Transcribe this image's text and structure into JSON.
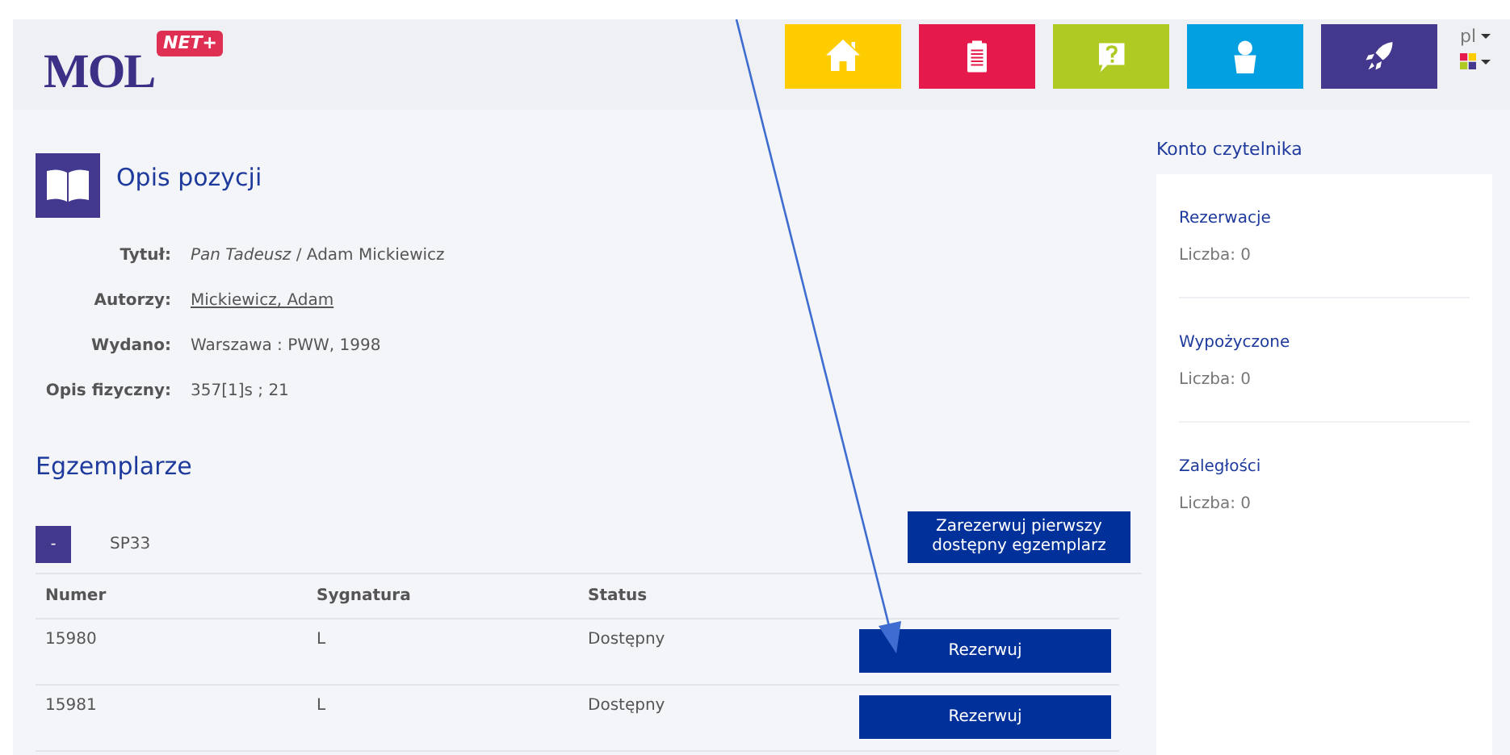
{
  "header": {
    "logo": {
      "text": "MOL",
      "badge": "NET+"
    },
    "nav": [
      {
        "kind": "home",
        "color": "#ffcc00"
      },
      {
        "kind": "clipboard",
        "color": "#e5194b"
      },
      {
        "kind": "help",
        "color": "#afca22"
      },
      {
        "kind": "user",
        "color": "#02a0e0"
      },
      {
        "kind": "rocket",
        "color": "#42398f"
      }
    ],
    "language": "pl"
  },
  "item": {
    "title": "Opis pozycji",
    "fields": [
      {
        "label": "Tytuł:",
        "value": "*Pan Tadeusz* / Adam Mickiewicz",
        "kind": "text"
      },
      {
        "label": "Autorzy:",
        "value": "Mickiewicz, Adam",
        "kind": "link"
      },
      {
        "label": "Wydano:",
        "value": "Warszawa : PWW, 1998",
        "kind": "text"
      },
      {
        "label": "Opis fizyczny:",
        "value": "357[1]s ; 21",
        "kind": "text"
      }
    ]
  },
  "copies": {
    "title": "Egzemplarze",
    "group": {
      "toggle": "-",
      "name": "SP33",
      "reserve_first": "Zarezerwuj pierwszy dostępny egzemplarz"
    },
    "columns": [
      "Numer",
      "Sygnatura",
      "Status"
    ],
    "rows": [
      {
        "number": "15980",
        "signature": "L",
        "status": "Dostępny",
        "action": "Rezerwuj"
      },
      {
        "number": "15981",
        "signature": "L",
        "status": "Dostępny",
        "action": "Rezerwuj"
      }
    ]
  },
  "sidebar": {
    "title": "Konto czytelnika",
    "sections": [
      {
        "title": "Rezerwacje",
        "count": "Liczba: 0"
      },
      {
        "title": "Wypożyczone",
        "count": "Liczba: 0"
      },
      {
        "title": "Zaległości",
        "count": "Liczba: 0"
      }
    ]
  }
}
